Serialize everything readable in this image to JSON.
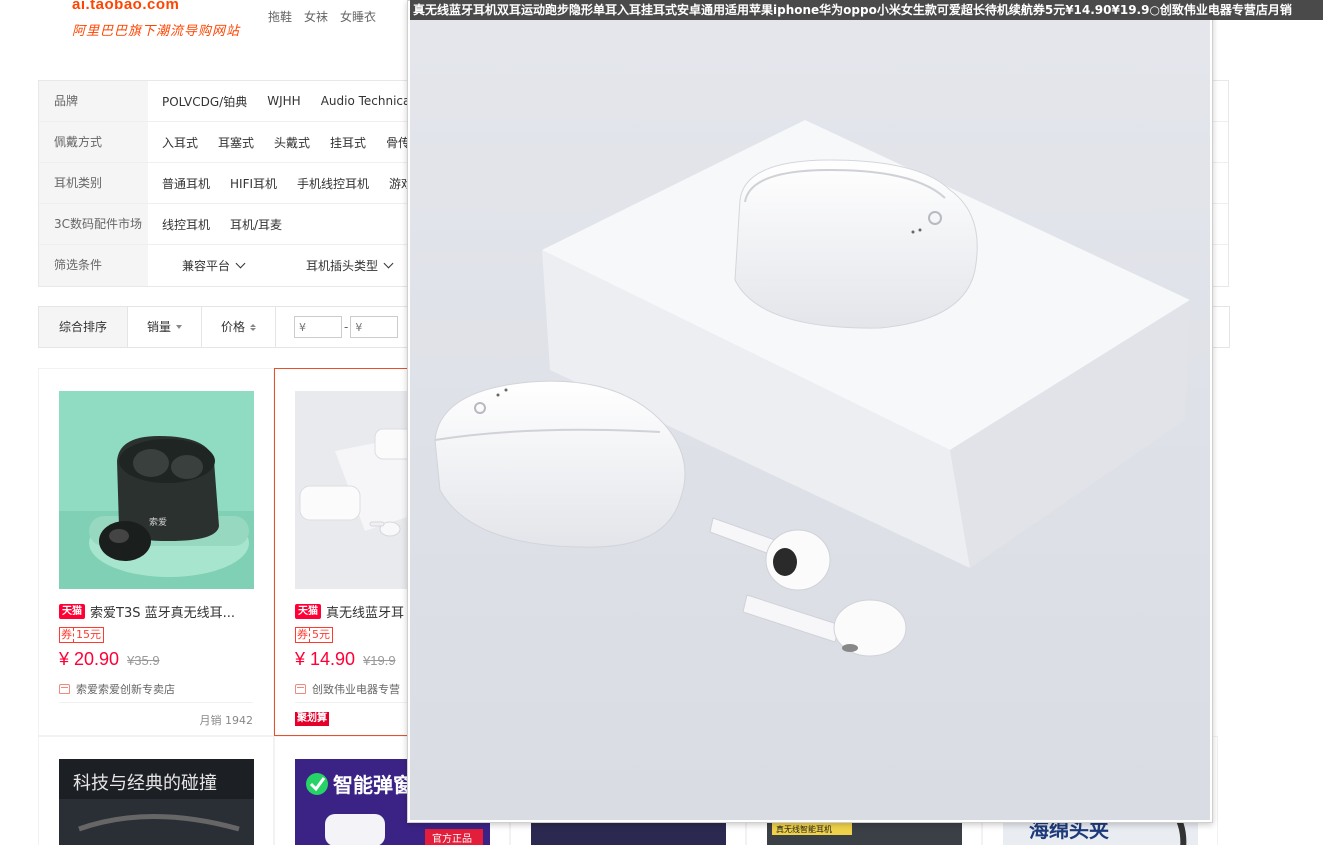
{
  "header": {
    "logo_url": "ai.taobao.com",
    "logo_slogan": "阿里巴巴旗下潮流导购网站",
    "nav": [
      "拖鞋",
      "女袜",
      "女睡衣"
    ]
  },
  "filters": [
    {
      "label": "品牌",
      "values": [
        "POLVCDG/铂典",
        "WJHH",
        "Audio Technica/"
      ]
    },
    {
      "label": "佩戴方式",
      "values": [
        "入耳式",
        "耳塞式",
        "头戴式",
        "挂耳式",
        "骨传"
      ]
    },
    {
      "label": "耳机类别",
      "values": [
        "普通耳机",
        "HIFI耳机",
        "手机线控耳机",
        "游戏"
      ]
    },
    {
      "label": "3C数码配件市场",
      "values": [
        "线控耳机",
        "耳机/耳麦"
      ]
    },
    {
      "label": "筛选条件",
      "dropdowns": [
        "兼容平台",
        "耳机插头类型"
      ]
    }
  ],
  "sort": {
    "default": "综合排序",
    "sales": "销量",
    "price": "价格",
    "price_min_placeholder": "¥",
    "price_max_placeholder": "¥",
    "dash": "-"
  },
  "products": [
    {
      "badge": "天猫",
      "title": "索爱T3S 蓝牙真无线耳...",
      "coupon_label": "券",
      "coupon_value": "15元",
      "price": "¥ 20.90",
      "old_price": "¥35.9",
      "shop": "索爱索爱创新专卖店",
      "sales": "月销 1942"
    },
    {
      "badge": "天猫",
      "title": "真无线蓝牙耳",
      "coupon_label": "券",
      "coupon_value": "5元",
      "price": "¥ 14.90",
      "old_price": "¥19.9",
      "shop": "创致伟业电器专营",
      "promo": "聚划算"
    }
  ],
  "row2": [
    {
      "banner_text": "科技与经典的碰撞"
    },
    {
      "banner_text": "智能弹窗",
      "tag": "官方正品"
    },
    {
      "banner_text": ""
    },
    {
      "banner_text": "真无线智能耳机"
    },
    {
      "banner_text": "海绵头夹"
    }
  ],
  "popup": {
    "title": "真无线蓝牙耳机双耳运动跑步隐形单耳入耳挂耳式安卓通用适用苹果iphone华为oppo小米女生款可爱超长待机续航券5元¥14.90¥19.9○创致伟业电器专营店月销"
  },
  "colors": {
    "accent": "#ff0036",
    "brand": "#ff4400",
    "hover_border": "#e5512d"
  }
}
